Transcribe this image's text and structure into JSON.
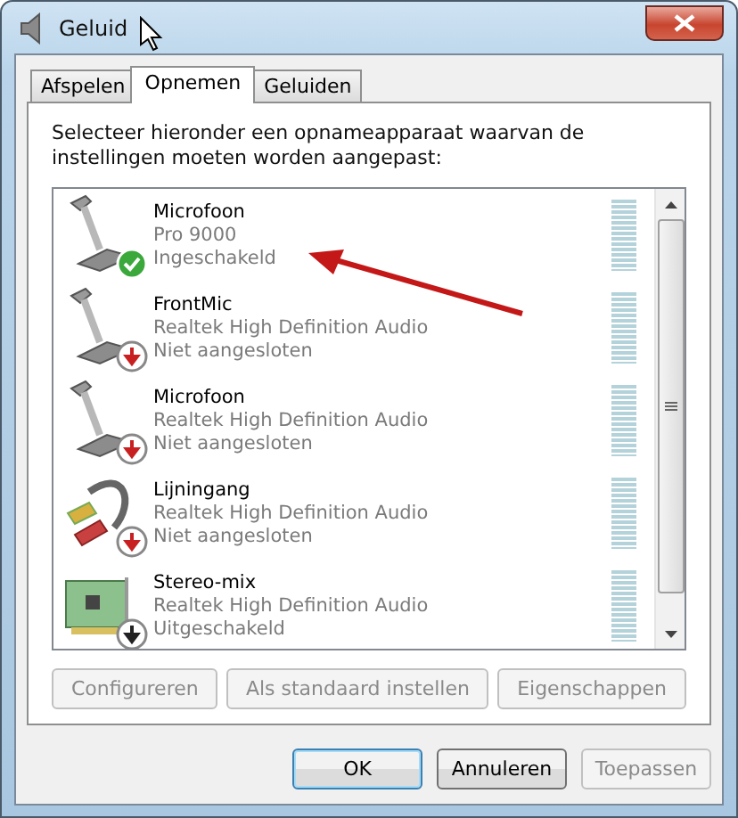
{
  "window": {
    "title": "Geluid"
  },
  "tabs": [
    {
      "label": "Afspelen",
      "selected": false
    },
    {
      "label": "Opnemen",
      "selected": true
    },
    {
      "label": "Geluiden",
      "selected": false
    }
  ],
  "instruction": "Selecteer hieronder een opnameapparaat waarvan de instellingen moeten worden aangepast:",
  "devices": [
    {
      "kind": "mic",
      "connected": true,
      "enabled": true,
      "name": "Microfoon",
      "description": "Pro 9000",
      "state": "Ingeschakeld"
    },
    {
      "kind": "mic",
      "connected": false,
      "name": "FrontMic",
      "description": "Realtek High Definition Audio",
      "state": "Niet aangesloten"
    },
    {
      "kind": "mic",
      "connected": false,
      "name": "Microfoon",
      "description": "Realtek High Definition Audio",
      "state": "Niet aangesloten"
    },
    {
      "kind": "line",
      "connected": false,
      "name": "Lijningang",
      "description": "Realtek High Definition Audio",
      "state": "Niet aangesloten"
    },
    {
      "kind": "card",
      "connected": true,
      "enabled": false,
      "name": "Stereo-mix",
      "description": "Realtek High Definition Audio",
      "state": "Uitgeschakeld"
    }
  ],
  "device_buttons": [
    {
      "label": "Configureren",
      "disabled": true
    },
    {
      "label": "Als standaard instellen",
      "disabled": true
    },
    {
      "label": "Eigenschappen",
      "disabled": true
    }
  ],
  "dialog_buttons": [
    {
      "label": "OK",
      "disabled": false,
      "default": true
    },
    {
      "label": "Annuleren",
      "disabled": false,
      "default": false
    },
    {
      "label": "Toepassen",
      "disabled": true,
      "default": false
    }
  ]
}
